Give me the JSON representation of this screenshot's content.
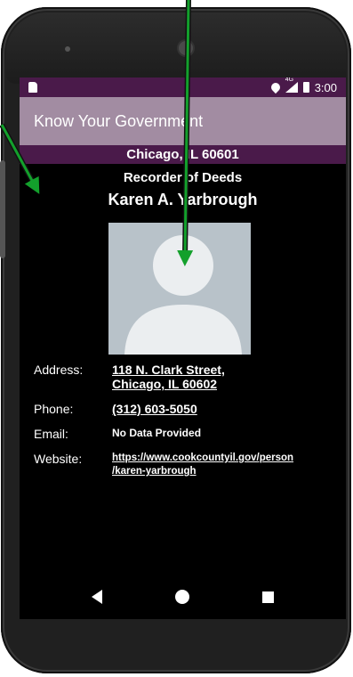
{
  "status_bar": {
    "time": "3:00",
    "network": "4G",
    "icons": [
      "sd-card-icon",
      "location-icon",
      "signal-icon",
      "battery-icon"
    ]
  },
  "app_bar": {
    "title": "Know Your Government"
  },
  "location": {
    "text": "Chicago, IL 60601"
  },
  "official": {
    "office": "Recorder of Deeds",
    "name": "Karen A. Yarbrough",
    "photo_icon": "person-placeholder-icon"
  },
  "details": {
    "address_label": "Address:",
    "address_line1": "118 N. Clark Street,",
    "address_line2": "Chicago, IL 60602",
    "phone_label": "Phone:",
    "phone_value": "(312) 603-5050",
    "email_label": "Email:",
    "email_value": "No Data Provided",
    "website_label": "Website:",
    "website_line1": "https://www.cookcountyil.gov/person",
    "website_line2": "/karen-yarbrough"
  },
  "nav": {
    "icons": [
      "back-icon",
      "home-icon",
      "recents-icon"
    ]
  },
  "colors": {
    "status_bar": "#4a1a4a",
    "app_bar": "#a28ca2",
    "screen_bg": "#000000",
    "annotation_arrow": "#13a02c"
  }
}
